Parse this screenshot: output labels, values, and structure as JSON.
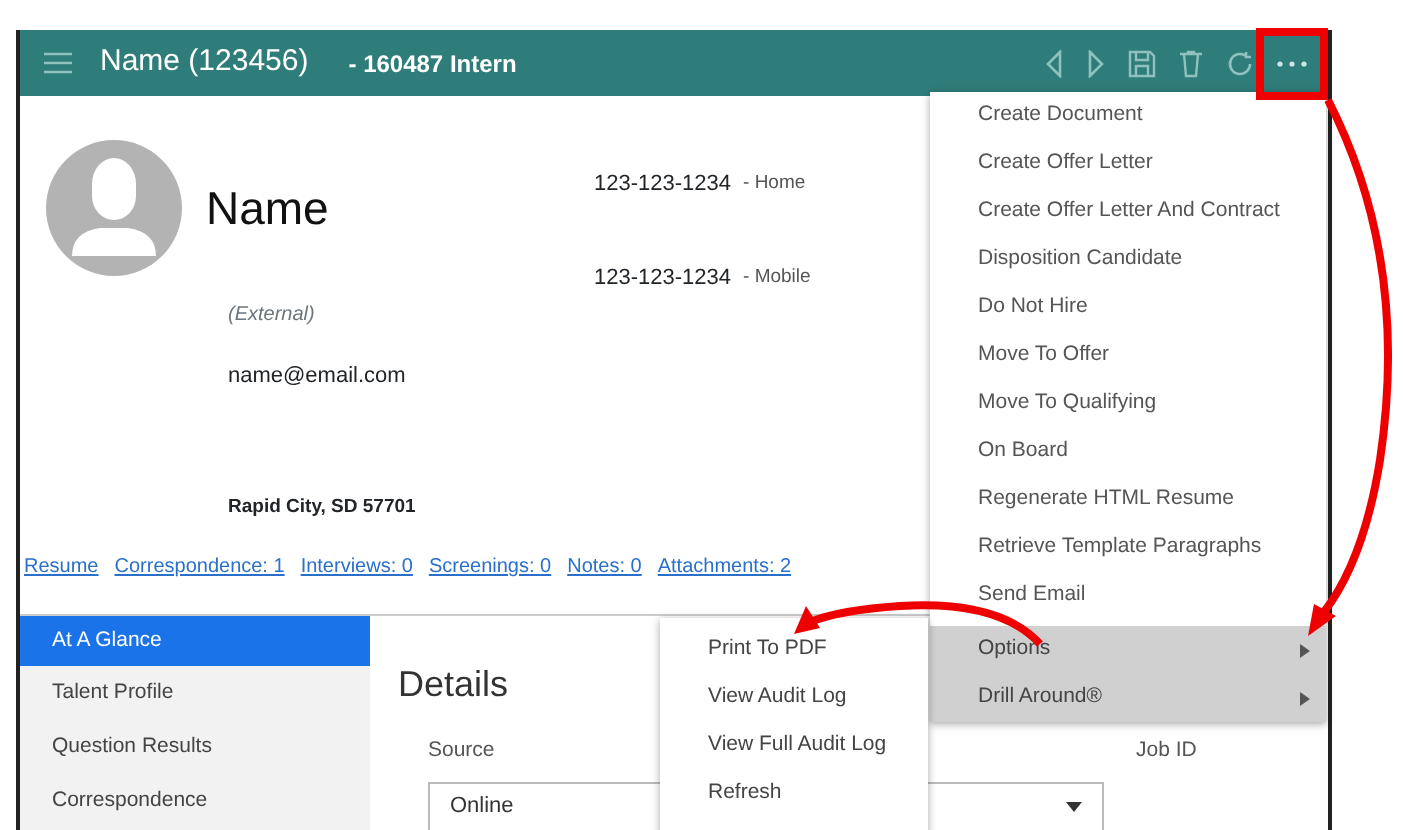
{
  "header": {
    "title": "Name (123456)",
    "subtitle": "- 160487 Intern"
  },
  "profile": {
    "name": "Name",
    "origin": "(External)",
    "email": "name@email.com",
    "address": "Rapid City, SD 57701",
    "phones": [
      {
        "number": "123-123-1234",
        "label": "- Home"
      },
      {
        "number": "123-123-1234",
        "label": "- Mobile"
      }
    ],
    "links": [
      "Resume",
      "Correspondence: 1",
      "Interviews: 0",
      "Screenings: 0",
      "Notes: 0",
      "Attachments: 2"
    ]
  },
  "sidebar": {
    "items": [
      {
        "label": "At A Glance",
        "selected": true
      },
      {
        "label": "Talent Profile",
        "selected": false
      },
      {
        "label": "Question Results",
        "selected": false
      },
      {
        "label": "Correspondence",
        "selected": false
      }
    ]
  },
  "details": {
    "title": "Details",
    "source_label": "Source",
    "source_value": "Online",
    "job_id_label": "Job ID"
  },
  "actions_menu": {
    "items": [
      {
        "label": "Create Document",
        "kind": "action"
      },
      {
        "label": "Create Offer Letter",
        "kind": "action"
      },
      {
        "label": "Create Offer Letter And Contract",
        "kind": "action"
      },
      {
        "label": "Disposition Candidate",
        "kind": "action"
      },
      {
        "label": "Do Not Hire",
        "kind": "action"
      },
      {
        "label": "Move To Offer",
        "kind": "action"
      },
      {
        "label": "Move To Qualifying",
        "kind": "action"
      },
      {
        "label": "On Board",
        "kind": "action"
      },
      {
        "label": "Regenerate HTML Resume",
        "kind": "action"
      },
      {
        "label": "Retrieve Template Paragraphs",
        "kind": "action"
      },
      {
        "label": "Send Email",
        "kind": "action"
      },
      {
        "label": "Options",
        "kind": "submenu"
      },
      {
        "label": "Drill Around®",
        "kind": "submenu"
      }
    ]
  },
  "options_submenu": {
    "items": [
      "Print To PDF",
      "View Audit Log",
      "View Full Audit Log",
      "Refresh"
    ]
  }
}
